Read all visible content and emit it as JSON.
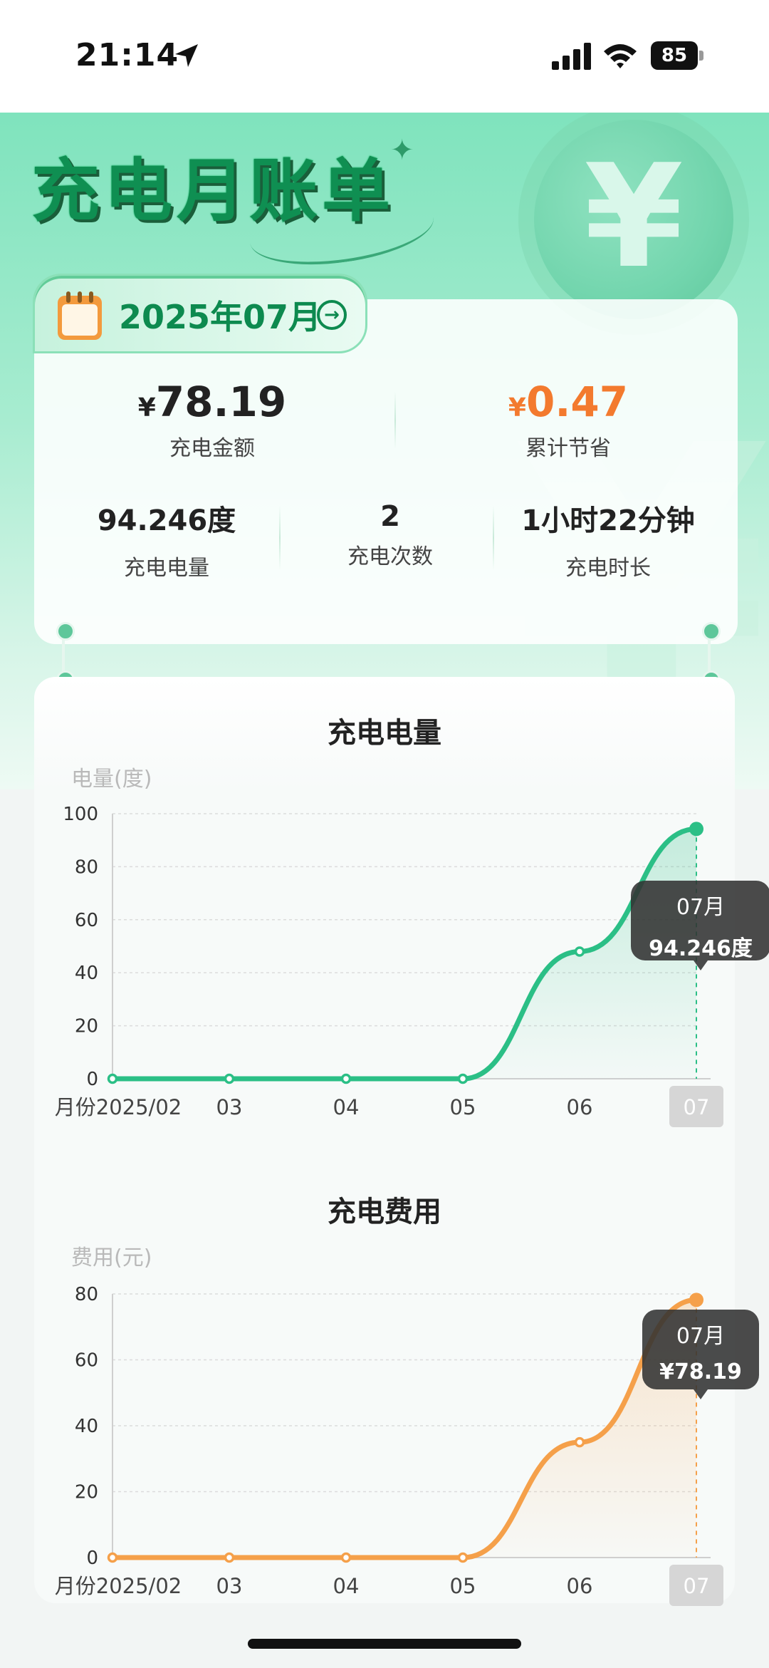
{
  "status_bar": {
    "time": "21:14",
    "battery": "85"
  },
  "hero": {
    "title": "充电月账单",
    "month": "2025年07月",
    "coin_symbol": "¥"
  },
  "summary": {
    "amount": {
      "currency": "¥",
      "value": "78.19",
      "label": "充电金额"
    },
    "saved": {
      "currency": "¥",
      "value": "0.47",
      "label": "累计节省"
    },
    "stats": [
      {
        "value": "94.246度",
        "label": "充电电量"
      },
      {
        "value": "2",
        "label": "充电次数"
      },
      {
        "value": "1小时22分钟",
        "label": "充电时长"
      }
    ]
  },
  "chart_data": [
    {
      "type": "line",
      "title": "充电电量",
      "ylabel": "电量(度)",
      "xlabel": "月份",
      "categories": [
        "2025/02",
        "03",
        "04",
        "05",
        "06",
        "07"
      ],
      "series": [
        {
          "values": [
            0,
            0,
            0,
            0,
            48,
            94.246
          ]
        }
      ],
      "ylim": [
        0,
        100
      ],
      "yticks": [
        0,
        20,
        40,
        60,
        80,
        100
      ],
      "color": "#2bbf86",
      "selected_index": 5,
      "tooltip": {
        "label": "07月",
        "value": "94.246度"
      }
    },
    {
      "type": "area",
      "title": "充电费用",
      "ylabel": "费用(元)",
      "xlabel": "月份",
      "categories": [
        "2025/02",
        "03",
        "04",
        "05",
        "06",
        "07"
      ],
      "series": [
        {
          "values": [
            0,
            0,
            0,
            0,
            35,
            78.19
          ]
        }
      ],
      "ylim": [
        0,
        80
      ],
      "yticks": [
        0,
        20,
        40,
        60,
        80
      ],
      "color": "#f5a04a",
      "selected_index": 5,
      "tooltip": {
        "label": "07月",
        "value": "¥78.19"
      }
    }
  ]
}
